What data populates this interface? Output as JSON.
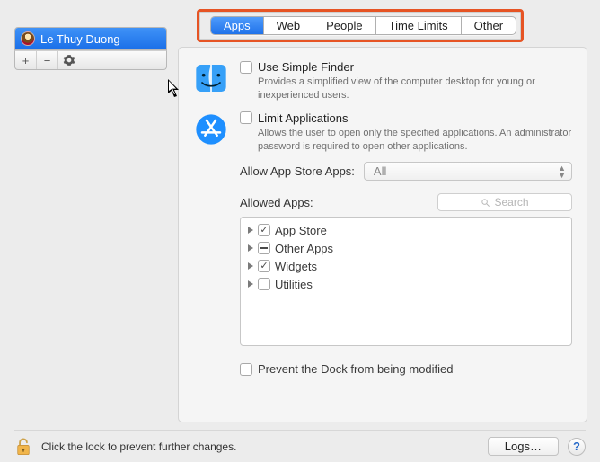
{
  "sidebar": {
    "users": [
      {
        "name": "Le Thuy Duong"
      }
    ],
    "toolbar": {
      "add": "+",
      "remove": "−"
    }
  },
  "tabs": {
    "items": [
      "Apps",
      "Web",
      "People",
      "Time Limits",
      "Other"
    ],
    "active": 0
  },
  "options": {
    "simpleFinder": {
      "label": "Use Simple Finder",
      "desc": "Provides a simplified view of the computer desktop for young or inexperienced users."
    },
    "limitApps": {
      "label": "Limit Applications",
      "desc": "Allows the user to open only the specified applications. An administrator password is required to open other applications."
    }
  },
  "allowAppStore": {
    "label": "Allow App Store Apps:",
    "value": "All"
  },
  "allowedApps": {
    "label": "Allowed Apps:",
    "searchPlaceholder": "Search",
    "tree": [
      {
        "label": "App Store",
        "state": "checked"
      },
      {
        "label": "Other Apps",
        "state": "dash"
      },
      {
        "label": "Widgets",
        "state": "checked"
      },
      {
        "label": "Utilities",
        "state": "unchecked"
      }
    ]
  },
  "preventDock": {
    "label": "Prevent the Dock from being modified"
  },
  "footer": {
    "lockText": "Click the lock to prevent further changes.",
    "logs": "Logs…",
    "help": "?"
  }
}
